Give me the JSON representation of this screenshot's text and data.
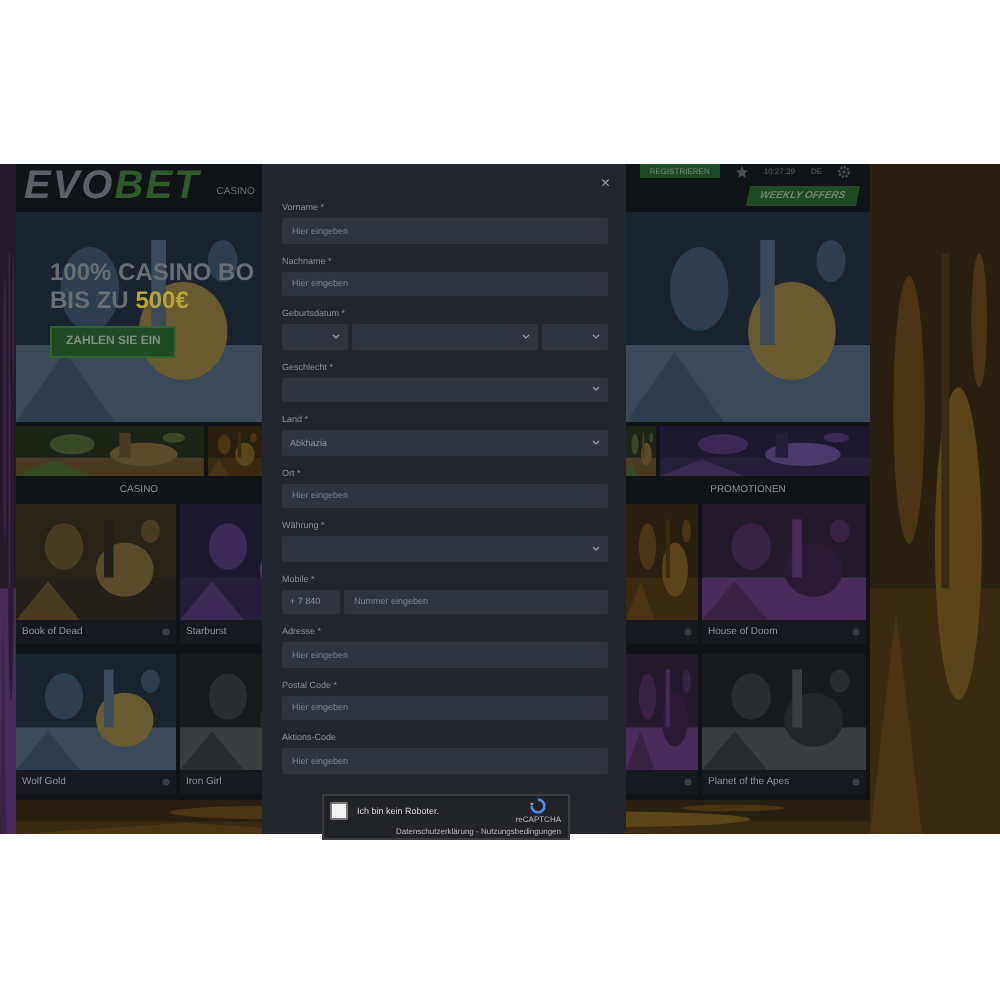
{
  "header": {
    "logo_left": "EVO",
    "logo_right": "BET",
    "nav": [
      {
        "label": "CASINO"
      }
    ],
    "register_button": "REGISTRIEREN",
    "time": "10:27:39",
    "language": "DE"
  },
  "weekly_offers": "WEEKLY OFFERS",
  "banner": {
    "headline": "100% CASINO BO",
    "subline": "BIS ZU",
    "amount": "500€",
    "button": "ZAHLEN SIE EIN"
  },
  "sections": [
    {
      "label": "CASINO"
    },
    {
      "label": "PROMOTIONEN"
    }
  ],
  "games_left": [
    {
      "label": "Book of Dead"
    },
    {
      "label": "Starburst"
    },
    {
      "label": "Wolf Gold"
    },
    {
      "label": "Iron Girl"
    }
  ],
  "games_right": [
    {
      "label": "House of Doom"
    },
    {
      "label": "Planet of the Apes"
    }
  ],
  "modal": {
    "close": "×",
    "fields": [
      {
        "kind": "text",
        "label": "Vorname *",
        "placeholder": "Hier eingeben"
      },
      {
        "kind": "text",
        "label": "Nachname *",
        "placeholder": "Hier eingeben"
      },
      {
        "kind": "date",
        "label": "Geburtsdatum *"
      },
      {
        "kind": "select",
        "label": "Geschlecht *"
      },
      {
        "kind": "select",
        "label": "Land *",
        "value": "Abkhazia"
      },
      {
        "kind": "text",
        "label": "Ort *",
        "placeholder": "Hier eingeben"
      },
      {
        "kind": "select",
        "label": "Währung *"
      },
      {
        "kind": "phone",
        "label": "Mobile *",
        "prefix": "+ 7 840",
        "placeholder": "Nummer eingeben"
      },
      {
        "kind": "text",
        "label": "Adresse *",
        "placeholder": "Hier eingeben"
      },
      {
        "kind": "text",
        "label": "Postal Code *",
        "placeholder": "Hier eingeben"
      },
      {
        "kind": "text",
        "label": "Aktions-Code",
        "placeholder": "Hier eingeben"
      }
    ],
    "captcha": {
      "label": "Ich bin kein Roboter.",
      "brand": "reCAPTCHA",
      "links": "Datenschutzerklärung - Nutzungsbedingungen",
      "checked": false
    }
  }
}
